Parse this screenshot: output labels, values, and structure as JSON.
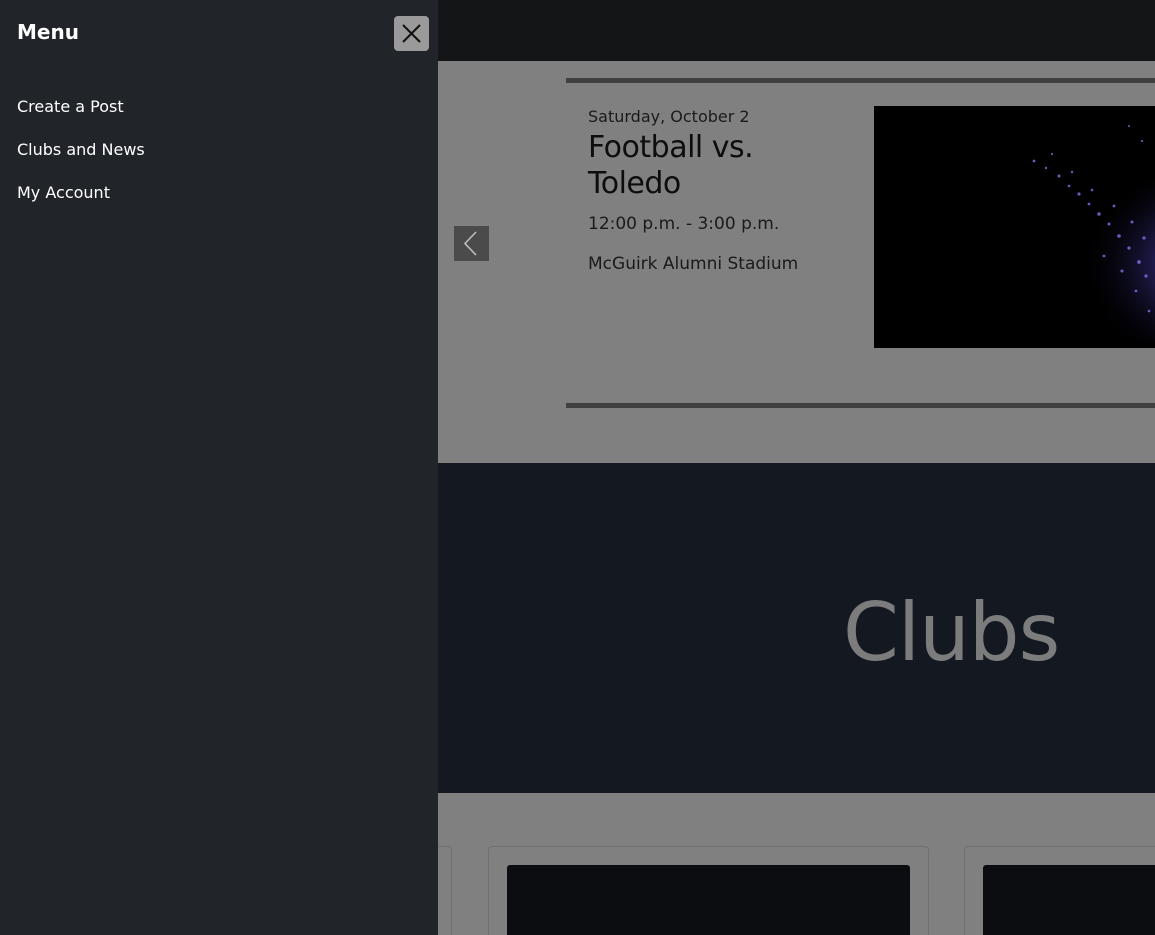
{
  "menu": {
    "title": "Menu",
    "close_icon": "close-icon",
    "items": [
      {
        "label": "Create a Post"
      },
      {
        "label": "Clubs and News"
      },
      {
        "label": "My Account"
      }
    ]
  },
  "event": {
    "date": "Saturday, October 2",
    "title": "Football vs. Toledo",
    "time": "12:00 p.m. - 3:00 p.m.",
    "location": "McGuirk Alumni Stadium",
    "prev_icon": "chevron-left-icon"
  },
  "clubs": {
    "heading": "Clubs"
  },
  "colors": {
    "menu_bg": "#212529",
    "topbar_bg": "#141517",
    "clubs_bg": "#131821",
    "overlay_gray": "#808080",
    "accent_purple": "#5a4fd6"
  }
}
